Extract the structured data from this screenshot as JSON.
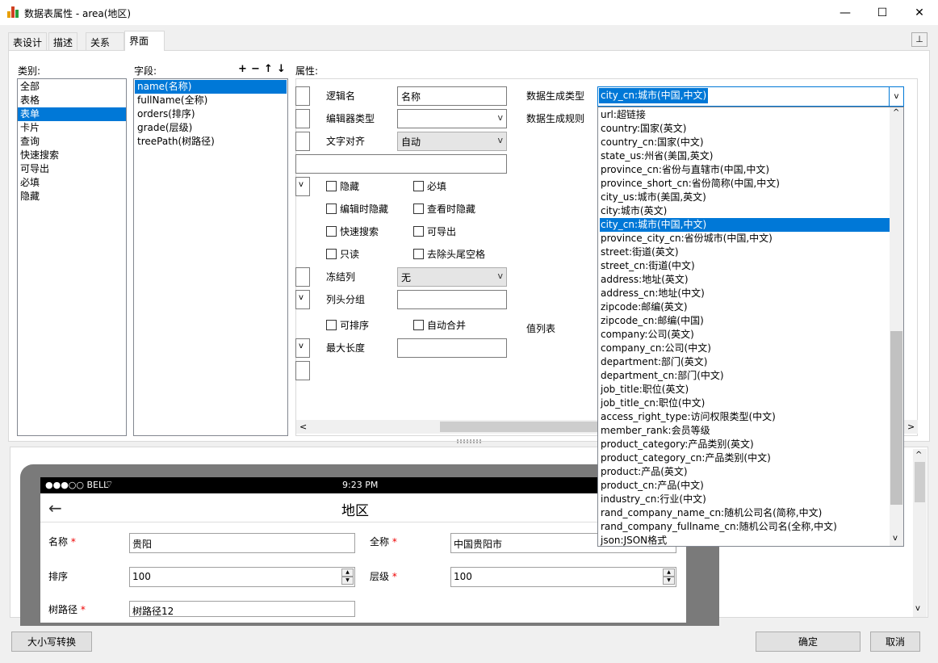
{
  "window": {
    "title": "数据表属性 - area(地区)"
  },
  "tabs": [
    "表设计",
    "描述",
    "关系",
    "界面"
  ],
  "category": {
    "label": "类别:",
    "items": [
      "全部",
      "表格",
      "表单",
      "卡片",
      "查询",
      "快速搜索",
      "可导出",
      "必填",
      "隐藏"
    ],
    "selected": 2
  },
  "fields": {
    "label": "字段:",
    "items": [
      "name(名称)",
      "fullName(全称)",
      "orders(排序)",
      "grade(层级)",
      "treePath(树路径)"
    ],
    "selected": 0
  },
  "properties": {
    "label": "属性:",
    "logic_name_label": "逻辑名",
    "logic_name_value": "名称",
    "editor_type_label": "编辑器类型",
    "editor_type_value": "",
    "text_align_label": "文字对齐",
    "text_align_value": "自动",
    "checkboxes": [
      "隐藏",
      "必填",
      "编辑时隐藏",
      "查看时隐藏",
      "快速搜索",
      "可导出",
      "只读",
      "去除头尾空格",
      "可排序",
      "自动合并"
    ],
    "freeze_col_label": "冻结列",
    "freeze_col_value": "无",
    "header_group_label": "列头分组",
    "max_length_label": "最大长度",
    "data_gen_type_label": "数据生成类型",
    "data_gen_rule_label": "数据生成规则",
    "value_list_label": "值列表",
    "data_gen_type_value": "city_cn:城市(中国,中文)"
  },
  "dropdown_items": [
    "url:超链接",
    "country:国家(英文)",
    "country_cn:国家(中文)",
    "state_us:州省(美国,英文)",
    "province_cn:省份与直辖市(中国,中文)",
    "province_short_cn:省份简称(中国,中文)",
    "city_us:城市(美国,英文)",
    "city:城市(英文)",
    "city_cn:城市(中国,中文)",
    "province_city_cn:省份城市(中国,中文)",
    "street:街道(英文)",
    "street_cn:街道(中文)",
    "address:地址(英文)",
    "address_cn:地址(中文)",
    "zipcode:邮编(英文)",
    "zipcode_cn:邮编(中国)",
    "company:公司(英文)",
    "company_cn:公司(中文)",
    "department:部门(英文)",
    "department_cn:部门(中文)",
    "job_title:职位(英文)",
    "job_title_cn:职位(中文)",
    "access_right_type:访问权限类型(中文)",
    "member_rank:会员等级",
    "product_category:产品类别(英文)",
    "product_category_cn:产品类别(中文)",
    "product:产品(英文)",
    "product_cn:产品(中文)",
    "industry_cn:行业(中文)",
    "rand_company_name_cn:随机公司名(简称,中文)",
    "rand_company_fullname_cn:随机公司名(全称,中文)",
    "json:JSON格式"
  ],
  "dropdown_selected": 8,
  "preview": {
    "status_left": "●●●○○ BELL",
    "status_time": "9:23 PM",
    "page_title": "地区",
    "back_icon": "arrow-left-icon",
    "name_label": "名称",
    "name_value": "贵阳",
    "fullname_label": "全称",
    "fullname_value": "中国贵阳市",
    "orders_label": "排序",
    "orders_value": "100",
    "grade_label": "层级",
    "grade_value": "100",
    "treepath_label": "树路径",
    "treepath_value": "树路径12",
    "required_mark": "*"
  },
  "buttons": {
    "case_convert": "大小写转换",
    "ok": "确定",
    "cancel": "取消"
  },
  "icons": {
    "minimize": "—",
    "maximize": "☐",
    "close": "✕",
    "pin": "⊥",
    "add": "+",
    "remove": "−",
    "up": "↑",
    "down": "↓",
    "scroll_up": "^",
    "scroll_down": "v",
    "chevron": "v"
  },
  "colors": {
    "accent": "#0078d7",
    "phone_frame": "#7a7a7a"
  }
}
